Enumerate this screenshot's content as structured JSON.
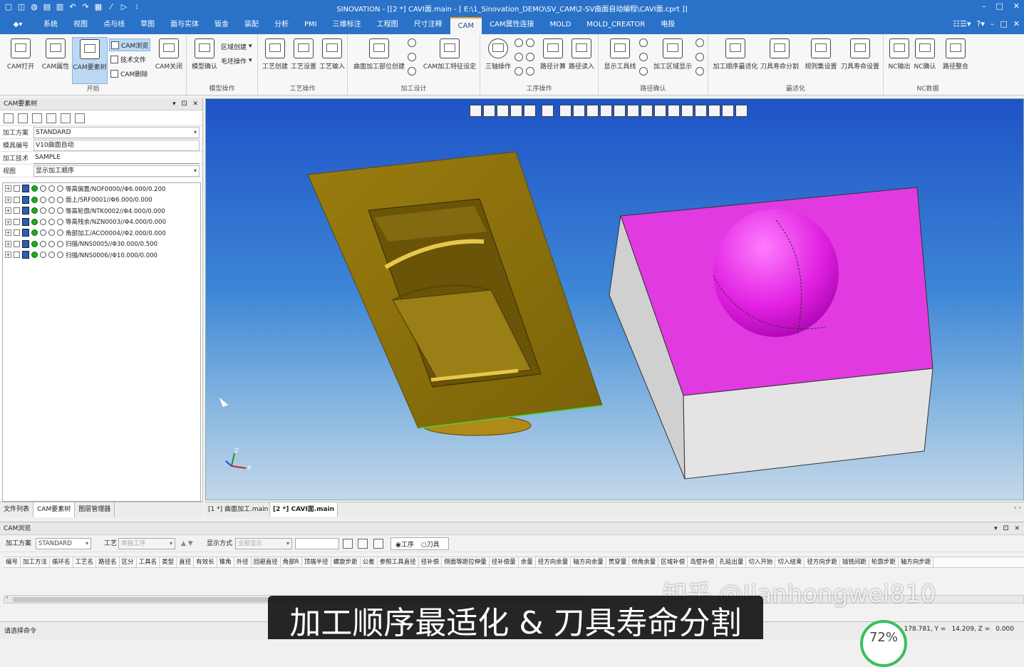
{
  "app": {
    "title": "SINOVATION - [[2 *] CAVI面.main - [ E:\\1_Sinovation_DEMO\\SV_CAM\\2-SV曲面自动编程\\CAVI面.cprt ]]",
    "win_min": "–",
    "win_max": "□",
    "win_close": "✕"
  },
  "menu": {
    "logo": "◆▾",
    "tabs": [
      "系统",
      "视图",
      "点与线",
      "草图",
      "面与实体",
      "钣金",
      "装配",
      "分析",
      "PMI",
      "三维标注",
      "工程图",
      "尺寸注释",
      "CAM",
      "CAM属性连接",
      "MOLD",
      "MOLD_CREATOR",
      "电极"
    ],
    "active": "CAM",
    "right_icons": [
      "☷☰▾",
      "?▾",
      "–",
      "□",
      "✕"
    ]
  },
  "ribbon": {
    "groups": [
      {
        "label": "开始",
        "big": [
          "CAM打开",
          "CAM属性",
          "CAM要素树",
          "CAM关闭"
        ],
        "small": [
          "CAM浏览",
          "技术文件",
          "CAM删除"
        ]
      },
      {
        "label": "模型操作",
        "big": [
          "模型确认"
        ],
        "small": [
          "区域创建",
          "毛坯操作"
        ]
      },
      {
        "label": "工艺操作",
        "big": [
          "工艺创建",
          "工艺设置",
          "工艺输入"
        ]
      },
      {
        "label": "加工设计",
        "big": [
          "曲面加工部位创建",
          "CAM加工特征设定"
        ]
      },
      {
        "label": "工序操作",
        "big": [
          "三轴操作",
          "路径计算",
          "路径读入"
        ]
      },
      {
        "label": "路径确认",
        "big": [
          "显示工具线",
          "加工区域显示"
        ]
      },
      {
        "label": "最适化",
        "big": [
          "加工顺序最适化",
          "刀具寿命分割",
          "规则集设置",
          "刀具寿命设置"
        ]
      },
      {
        "label": "NC数据",
        "big": [
          "NC输出",
          "NC确认",
          "路径整合"
        ]
      }
    ]
  },
  "left_panel": {
    "title": "CAM要素树",
    "ctrl": [
      "▾",
      "⚀",
      "✕"
    ],
    "props": [
      {
        "label": "加工方案",
        "value": "STANDARD"
      },
      {
        "label": "模具编号",
        "value": "V10曲面自动"
      },
      {
        "label": "加工技术",
        "value": "SAMPLE"
      },
      {
        "label": "视图",
        "value": "显示加工顺序"
      }
    ],
    "tree": [
      "等高偏置/NOF0000//Φ6.000/0.200",
      "面上/SRF0001//Φ6.000/0.000",
      "等高轮廓/NTK0002//Φ4.000/0.000",
      "等高残余/NZN0003//Φ4.000/0.000",
      "角部加工/ACO0004//Φ2.000/0.000",
      "扫描/NNS0005//Φ30.000/0.500",
      "扫描/NNS0006//Φ10.000/0.000"
    ],
    "tabs": [
      "文件列表",
      "CAM要素树",
      "图层管理器"
    ]
  },
  "doc_tabs": {
    "tab1": "[1 *] 曲面加工.main",
    "tab2": "[2 *] CAVI面.main",
    "arrows": "‹  ›"
  },
  "axis": {
    "z": "Z",
    "x": "X"
  },
  "bottom_panel": {
    "title": "CAM浏览",
    "ctrl": [
      "▾",
      "⚀",
      "✕"
    ],
    "plan_label": "加工方案",
    "plan_value": "STANDARD",
    "process_label": "工艺",
    "process_value": "单独工序",
    "updown": "▲ ▼",
    "display_label": "显示方式",
    "display_value": "全部显示",
    "radio_a": "◉工序",
    "radio_b": "○刀具",
    "columns": [
      "编号",
      "加工方法",
      "循环名",
      "工艺名",
      "路径名",
      "区分",
      "工具名",
      "类型",
      "直径",
      "有效长",
      "锥角",
      "外径",
      "回避直径",
      "角部R",
      "顶端半径",
      "螺旋步距",
      "公差",
      "参照工具直径",
      "径补偿",
      "侧面等距拉伸量",
      "径补偿量",
      "余量",
      "径方向余量",
      "轴方向余量",
      "贯穿量",
      "倒角余量",
      "区域补偿",
      "岛壁补偿",
      "孔延出量",
      "切入开始",
      "切入结束",
      "径方向步距",
      "插铣间距",
      "轮廓步距",
      "轴方向步距"
    ],
    "scroll_arrow": "‹"
  },
  "status": {
    "text": "请选择命令",
    "y": "178.781, Y =",
    "z": "14.209, Z =",
    "zval": "0.000",
    "gauge": "72%"
  },
  "overlay": {
    "caption": "加工顺序最适化 & 刀具寿命分割",
    "watermark": "知乎 @Jianhongwei810"
  }
}
